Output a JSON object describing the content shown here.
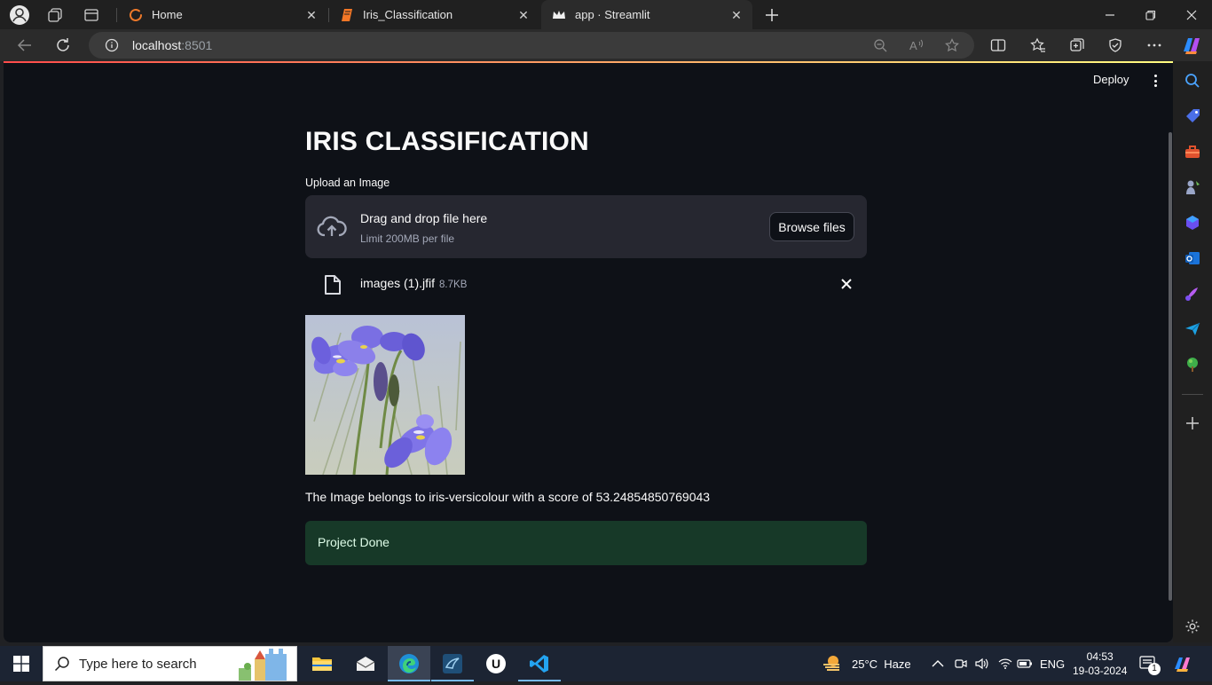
{
  "browser": {
    "tabs": [
      {
        "title": "Home"
      },
      {
        "title": "Iris_Classification"
      },
      {
        "title": "app · Streamlit"
      }
    ],
    "url_host": "localhost",
    "url_port": ":8501"
  },
  "page": {
    "toolbar": {
      "deploy_label": "Deploy"
    },
    "title": "IRIS CLASSIFICATION",
    "uploader": {
      "label": "Upload an Image",
      "drag_text": "Drag and drop file here",
      "limit_text": "Limit 200MB per file",
      "browse_label": "Browse files"
    },
    "uploaded_file": {
      "name": "images (1).jfif",
      "size": "8.7KB"
    },
    "result_text": "The Image belongs to iris-versicolour with a score of 53.24854850769043",
    "success_text": "Project Done"
  },
  "taskbar": {
    "search_placeholder": "Type here to search",
    "weather": "25°C  Haze",
    "language": "ENG",
    "time": "04:53",
    "date": "19-03-2024",
    "notification_count": "1"
  },
  "colors": {
    "page_bg": "#0e1117",
    "dropzone_bg": "#262730",
    "success_bg": "#173928",
    "accent": "#ff4b4b"
  }
}
